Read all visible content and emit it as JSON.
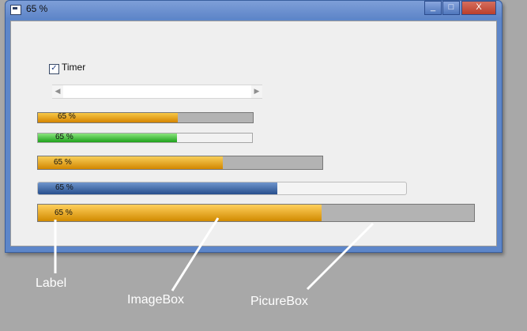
{
  "window": {
    "title": "65 %",
    "buttons": {
      "minimize": "_",
      "maximize": "□",
      "close": "X"
    }
  },
  "controls": {
    "timer": {
      "label": "Timer",
      "checked": true,
      "check_glyph": "✓"
    },
    "scrollbar": {
      "left_glyph": "◀",
      "right_glyph": "▶"
    }
  },
  "bars": [
    {
      "label": "65 %",
      "value": 0.65
    },
    {
      "label": "65 %",
      "value": 0.65
    },
    {
      "label": "65 %",
      "value": 0.65
    },
    {
      "label": "65 %",
      "value": 0.65
    },
    {
      "label": "65 %",
      "value": 0.65
    }
  ],
  "annotations": {
    "label": "Label",
    "imagebox": "ImageBox",
    "picturebox": "PicureBox"
  },
  "colors": {
    "desktop": "#a8a8a8",
    "title_blue": "#5d86c9"
  }
}
